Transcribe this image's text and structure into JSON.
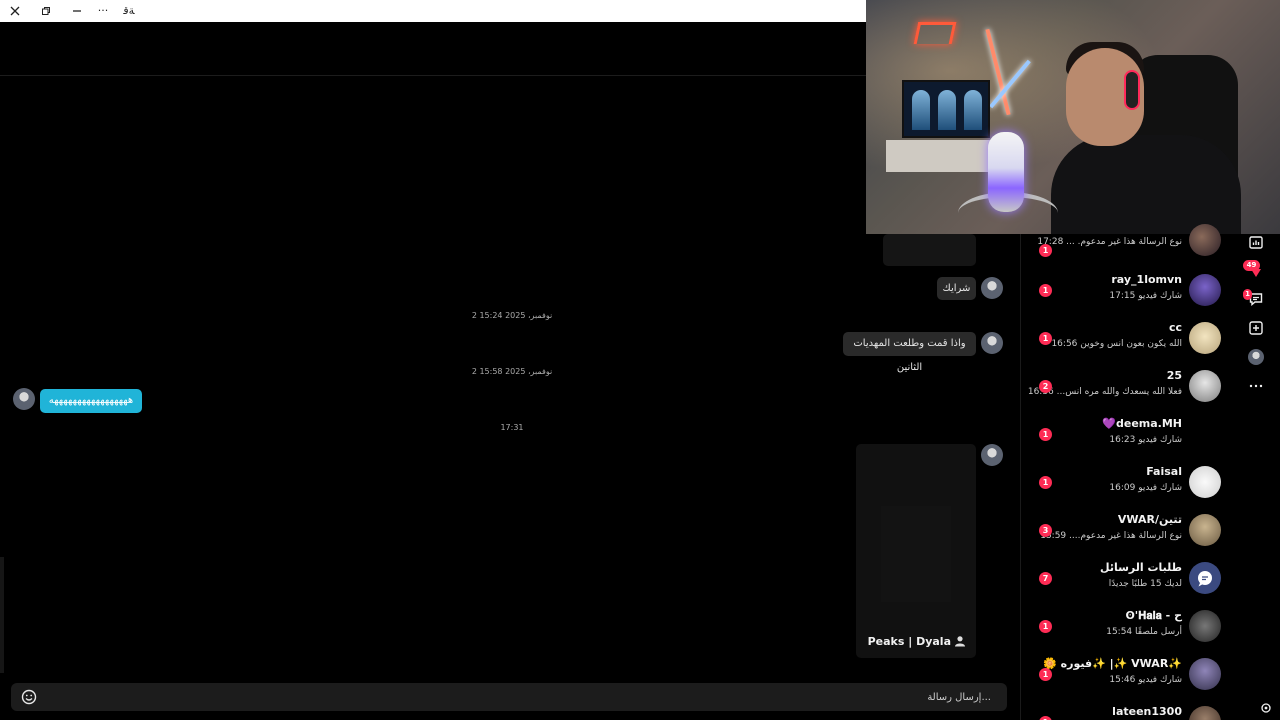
{
  "window": {
    "close_icon": "close-icon",
    "restore_icon": "restore-icon",
    "minimize_icon": "minimize-icon",
    "more_label": "···",
    "lang_label": "ﺔﻗ"
  },
  "chat": {
    "messages": [
      {
        "text": "شرايك"
      },
      {
        "timestamp": "2 نوفمبر، 2025 15:24"
      },
      {
        "text": "واذا قمت وطلعت المهديات الثانين"
      },
      {
        "timestamp": "2 نوفمبر، 2025 15:58"
      },
      {
        "text": "هههههههههههههههههه"
      },
      {
        "timestamp": "17:31"
      },
      {
        "card_name": "Peaks | Dyala"
      }
    ],
    "composer_placeholder": "إرسال رسالة...",
    "emoji_icon": "emoji-icon"
  },
  "conversations": [
    {
      "name": "",
      "preview": "نوع الرسالة هذا غير مدعوم. ...",
      "time": "17:28",
      "badge": "1"
    },
    {
      "name": "ray_1lomvn",
      "preview": "شارك فيديو",
      "time": "17:15",
      "badge": "1"
    },
    {
      "name": "cc",
      "preview": "الله يكون بعون انس وخوين",
      "time": "16:56",
      "badge": "1"
    },
    {
      "name": "25",
      "preview": "فعلا الله يسعدك والله مره انس...",
      "time": "16:36",
      "badge": "2"
    },
    {
      "name": "deema.MH💜",
      "preview": "شارك فيديو",
      "time": "16:23",
      "badge": "1"
    },
    {
      "name": "Faisal",
      "preview": "شارك فيديو",
      "time": "16:09",
      "badge": "1"
    },
    {
      "name": "تتين/VWAR",
      "preview": "نوع الرسالة هذا غير مدعوم....",
      "time": "15:59",
      "badge": "3"
    },
    {
      "name": "طلبات الرسائل",
      "preview": "لديك 15 طلبًا جديدًا",
      "time": "",
      "badge": "7"
    },
    {
      "name": "ح - ʘ'𝐇𝐚𝐥𝐚",
      "preview": "أرسل ملصقًا",
      "time": "15:54",
      "badge": "1"
    },
    {
      "name": "✨VWAR ✨| ✨فيوره 🌼",
      "preview": "شارك فيديو",
      "time": "15:46",
      "badge": "1"
    },
    {
      "name": "lateen1300",
      "preview": "",
      "time": "",
      "badge": "1"
    }
  ],
  "rail": {
    "badge_heart": "49",
    "badge_msg": "1"
  },
  "colors": {
    "accent_blue": "#20b4d8",
    "badge_red": "#fe2c55",
    "bubble_dark": "#2a2a2a"
  }
}
